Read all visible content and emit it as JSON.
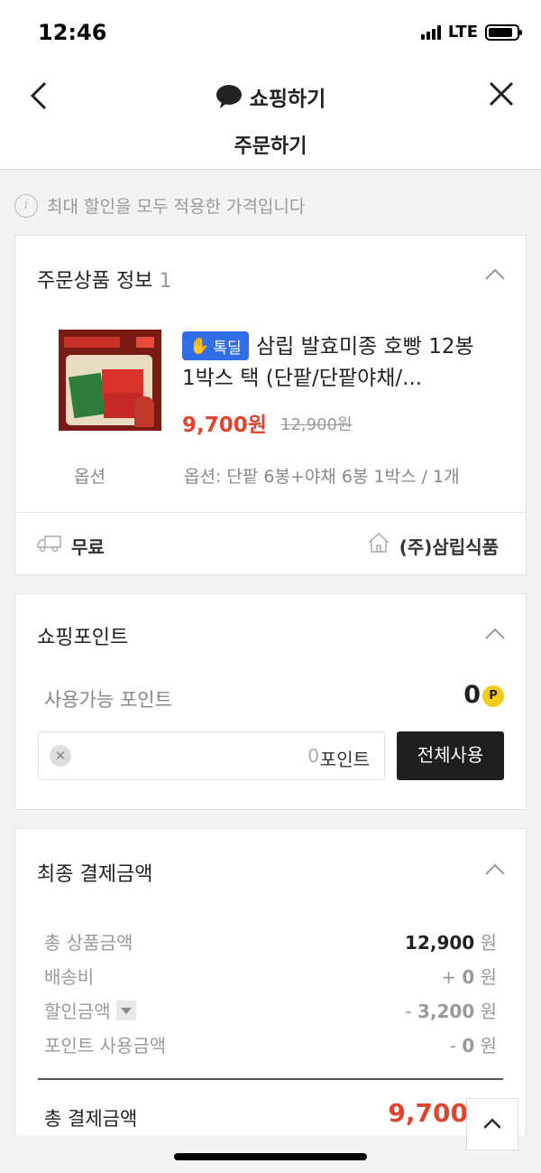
{
  "status_bar": {
    "time": "12:46",
    "network": "LTE"
  },
  "nav": {
    "title": "쇼핑하기",
    "subheader": "주문하기"
  },
  "notice": {
    "text": "최대 할인을 모두 적용한 가격입니다"
  },
  "order_info": {
    "title": "주문상품 정보",
    "count": "1",
    "product": {
      "tag": "톡딜",
      "name": "삼립 발효미종 호빵 12봉 1박스 택 (단팥/단팥야채/...",
      "price": "9,700원",
      "original_price": "12,900원"
    },
    "option_label": "옵션",
    "option_value": "옵션: 단팥 6봉+야채 6봉 1박스 / 1개",
    "shipping": "무료",
    "seller": "(주)삼립식품"
  },
  "shopping_point": {
    "title": "쇼핑포인트",
    "available_label": "사용가능 포인트",
    "available_value": "0",
    "point_badge": "P",
    "input_value": "0",
    "input_unit": "포인트",
    "use_all_label": "전체사용"
  },
  "final_payment": {
    "title": "최종 결제금액",
    "rows": [
      {
        "label": "총 상품금액",
        "sign": "",
        "value": "12,900",
        "unit": "원"
      },
      {
        "label": "배송비",
        "sign": "+ ",
        "value": "0",
        "unit": "원"
      },
      {
        "label": "할인금액",
        "sign": "- ",
        "value": "3,200",
        "unit": "원"
      },
      {
        "label": "포인트 사용금액",
        "sign": "- ",
        "value": "0",
        "unit": "원"
      }
    ],
    "total_label": "총 결제금액",
    "total_value": "9,700"
  },
  "colors": {
    "accent": "#e2452c",
    "tag_blue": "#2f6ee6",
    "point_yellow": "#f5cc1e"
  },
  "icons": [
    "back-arrow-icon",
    "close-icon",
    "chat-bubble-icon",
    "info-icon",
    "chevron-up-icon",
    "truck-icon",
    "home-icon",
    "clear-icon",
    "point-icon",
    "dropdown-icon"
  ]
}
